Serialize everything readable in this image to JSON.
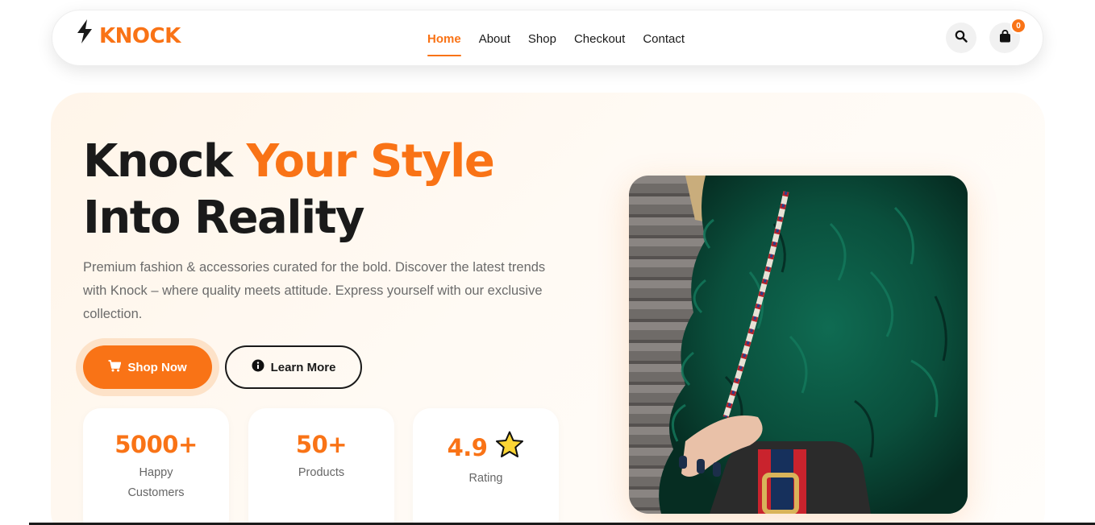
{
  "brand": {
    "name": "KNOCK",
    "logo_icon": "lightning-bolt-icon"
  },
  "nav": {
    "links": [
      {
        "label": "Home",
        "active": true
      },
      {
        "label": "About",
        "active": false
      },
      {
        "label": "Shop",
        "active": false
      },
      {
        "label": "Checkout",
        "active": false
      },
      {
        "label": "Contact",
        "active": false
      }
    ],
    "search_icon": "search-icon",
    "cart_icon": "shopping-bag-icon",
    "cart_count": "0"
  },
  "hero": {
    "headline_part1": "Knock ",
    "headline_accent": "Your Style",
    "headline_line2": "Into Reality",
    "description": "Premium fashion & accessories curated for the bold. Discover the latest trends with Knock – where quality meets attitude. Express yourself with our exclusive collection.",
    "primary_button": "Shop Now",
    "primary_icon": "cart-icon",
    "secondary_button": "Learn More",
    "secondary_icon": "info-icon",
    "image_subject": "green-fur-coat-with-handbag"
  },
  "stats": [
    {
      "value": "5000+",
      "label": "Happy Customers"
    },
    {
      "value": "50+",
      "label": "Products"
    },
    {
      "value": "4.9",
      "label": "Rating",
      "icon": "star-icon"
    }
  ],
  "colors": {
    "accent": "#f97316",
    "accent_light": "#fde2c8",
    "text": "#1a1a1a",
    "muted": "#6b6b6b"
  }
}
